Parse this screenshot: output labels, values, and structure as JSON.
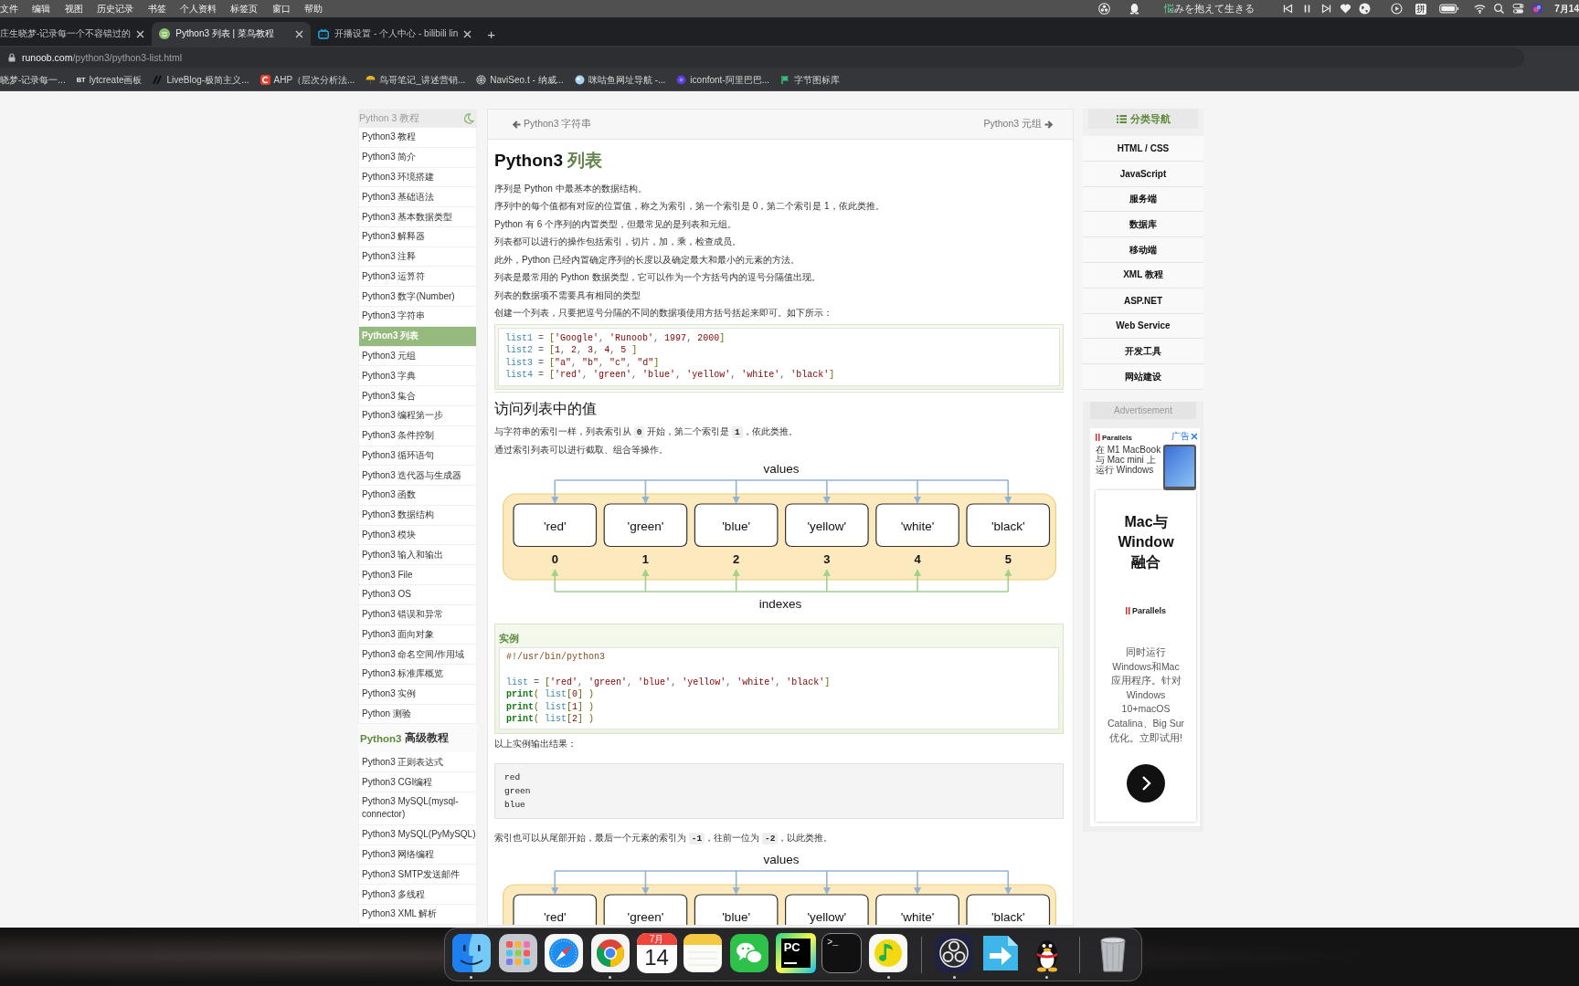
{
  "menu_bar": {
    "menus": [
      "文件",
      "编辑",
      "视图",
      "历史记录",
      "书签",
      "个人资料",
      "标签页",
      "窗口",
      "帮助"
    ],
    "now_playing": {
      "sung": "悩",
      "rest": "みを抱えて生きる"
    },
    "input_method": "拼",
    "clock": "7月14"
  },
  "tabs": [
    {
      "title": "庄生晓梦-记录每一个不容错过的",
      "kind": "cropped",
      "selected": false
    },
    {
      "title": "Python3 列表 | 菜鸟教程",
      "kind": "tutorial",
      "selected": true
    },
    {
      "title": "开播设置 - 个人中心 - bilibili lin",
      "kind": "video",
      "selected": false
    }
  ],
  "new_tab": "+",
  "address": {
    "host": "runoob.com",
    "path": "/python3/python3-list.html"
  },
  "bookmarks": [
    {
      "label": "晓梦-记录每一...",
      "kind": "cropped"
    },
    {
      "label": "lytcreate画板",
      "kind": "letters",
      "badge": "BT"
    },
    {
      "label": "LiveBlog-极简主义...",
      "kind": "slashes"
    },
    {
      "label": "AHP（层次分析法...",
      "kind": "ring-tile"
    },
    {
      "label": "鸟哥笔记_讲述营销...",
      "kind": "umbrella"
    },
    {
      "label": "NaviSeo.t - 纳威...",
      "kind": "globe"
    },
    {
      "label": "咪咕鱼网址导航 -...",
      "kind": "bubble"
    },
    {
      "label": "iconfont-阿里巴巴...",
      "kind": "disc"
    },
    {
      "label": "字节图标库",
      "kind": "flag"
    }
  ],
  "sidebar": {
    "header": "Python 3 教程",
    "items": [
      {
        "label": "Python3 教程",
        "selected": false
      },
      {
        "label": "Python3 简介",
        "selected": false
      },
      {
        "label": "Python3 环境搭建",
        "selected": false
      },
      {
        "label": "Python3 基础语法",
        "selected": false
      },
      {
        "label": "Python3 基本数据类型",
        "selected": false
      },
      {
        "label": "Python3 解释器",
        "selected": false
      },
      {
        "label": "Python3 注释",
        "selected": false
      },
      {
        "label": "Python3 运算符",
        "selected": false
      },
      {
        "label": "Python3 数字(Number)",
        "selected": false
      },
      {
        "label": "Python3 字符串",
        "selected": false
      },
      {
        "label": "Python3 列表",
        "selected": true
      },
      {
        "label": "Python3 元组",
        "selected": false
      },
      {
        "label": "Python3 字典",
        "selected": false
      },
      {
        "label": "Python3 集合",
        "selected": false
      },
      {
        "label": "Python3 编程第一步",
        "selected": false
      },
      {
        "label": "Python3 条件控制",
        "selected": false
      },
      {
        "label": "Python3 循环语句",
        "selected": false
      },
      {
        "label": "Python3 迭代器与生成器",
        "selected": false
      },
      {
        "label": "Python3 函数",
        "selected": false
      },
      {
        "label": "Python3 数据结构",
        "selected": false
      },
      {
        "label": "Python3 模块",
        "selected": false
      },
      {
        "label": "Python3 输入和输出",
        "selected": false
      },
      {
        "label": "Python3 File",
        "selected": false
      },
      {
        "label": "Python3 OS",
        "selected": false
      },
      {
        "label": "Python3 错误和异常",
        "selected": false
      },
      {
        "label": "Python3 面向对象",
        "selected": false
      },
      {
        "label": "Python3 命名空间/作用域",
        "selected": false
      },
      {
        "label": "Python3 标准库概览",
        "selected": false
      },
      {
        "label": "Python3 实例",
        "selected": false
      },
      {
        "label": "Python 测验",
        "selected": false
      }
    ],
    "section": {
      "lead": "Python3",
      "rest": "高级教程"
    },
    "advanced_items": [
      {
        "label": "Python3 正则表达式",
        "selected": false
      },
      {
        "label": "Python3 CGI编程",
        "selected": false
      },
      {
        "label": "Python3 MySQL(mysql-connector)",
        "selected": false
      },
      {
        "label": "Python3 MySQL(PyMySQL)",
        "selected": false
      },
      {
        "label": "Python3 网络编程",
        "selected": false
      },
      {
        "label": "Python3 SMTP发送邮件",
        "selected": false
      },
      {
        "label": "Python3 多线程",
        "selected": false
      },
      {
        "label": "Python3 XML 解析",
        "selected": false
      }
    ]
  },
  "article": {
    "prev": "Python3 字符串",
    "next": "Python3 元组",
    "title": {
      "lead": "Python3",
      "rest": "列表"
    },
    "body": [
      {
        "kind": "paragraph",
        "text": "序列是 Python 中最基本的数据结构。"
      },
      {
        "kind": "paragraph",
        "text": "序列中的每个值都有对应的位置值，称之为索引，第一个索引是 0，第二个索引是 1，依此类推。"
      },
      {
        "kind": "paragraph",
        "text": "Python 有 6 个序列的内置类型，但最常见的是列表和元组。"
      },
      {
        "kind": "paragraph",
        "text": "列表都可以进行的操作包括索引，切片，加，乘，检查成员。"
      },
      {
        "kind": "paragraph",
        "text": "此外，Python 已经内置确定序列的长度以及确定最大和最小的元素的方法。"
      },
      {
        "kind": "paragraph",
        "text": "列表是最常用的 Python 数据类型，它可以作为一个方括号内的逗号分隔值出现。"
      },
      {
        "kind": "paragraph",
        "text": "列表的数据项不需要具有相同的类型"
      },
      {
        "kind": "paragraph",
        "text": "创建一个列表，只要把逗号分隔的不同的数据项使用方括号括起来即可。如下所示："
      },
      {
        "kind": "code",
        "lines": [
          {
            "kind": "code",
            "tokens": [
              {
                "kind": "name",
                "text": "list1"
              },
              {
                "kind": "op",
                "text": " = "
              },
              {
                "kind": "punct",
                "text": "["
              },
              {
                "kind": "str",
                "text": "'Google'"
              },
              {
                "kind": "op",
                "text": ", "
              },
              {
                "kind": "str",
                "text": "'Runoob'"
              },
              {
                "kind": "op",
                "text": ", "
              },
              {
                "kind": "num",
                "text": "1997"
              },
              {
                "kind": "op",
                "text": ", "
              },
              {
                "kind": "num",
                "text": "2000"
              },
              {
                "kind": "punct",
                "text": "]"
              }
            ]
          },
          {
            "kind": "code",
            "tokens": [
              {
                "kind": "name",
                "text": "list2"
              },
              {
                "kind": "op",
                "text": " = "
              },
              {
                "kind": "punct",
                "text": "["
              },
              {
                "kind": "num",
                "text": "1"
              },
              {
                "kind": "op",
                "text": ", "
              },
              {
                "kind": "num",
                "text": "2"
              },
              {
                "kind": "op",
                "text": ", "
              },
              {
                "kind": "num",
                "text": "3"
              },
              {
                "kind": "op",
                "text": ", "
              },
              {
                "kind": "num",
                "text": "4"
              },
              {
                "kind": "op",
                "text": ", "
              },
              {
                "kind": "num",
                "text": "5"
              },
              {
                "kind": "punct",
                "text": " ]"
              }
            ]
          },
          {
            "kind": "code",
            "tokens": [
              {
                "kind": "name",
                "text": "list3"
              },
              {
                "kind": "op",
                "text": " = "
              },
              {
                "kind": "punct",
                "text": "["
              },
              {
                "kind": "str",
                "text": "\"a\""
              },
              {
                "kind": "op",
                "text": ", "
              },
              {
                "kind": "str",
                "text": "\"b\""
              },
              {
                "kind": "op",
                "text": ", "
              },
              {
                "kind": "str",
                "text": "\"c\""
              },
              {
                "kind": "op",
                "text": ", "
              },
              {
                "kind": "str",
                "text": "\"d\""
              },
              {
                "kind": "punct",
                "text": "]"
              }
            ]
          },
          {
            "kind": "code",
            "tokens": [
              {
                "kind": "name",
                "text": "list4"
              },
              {
                "kind": "op",
                "text": " = "
              },
              {
                "kind": "punct",
                "text": "["
              },
              {
                "kind": "str",
                "text": "'red'"
              },
              {
                "kind": "op",
                "text": ", "
              },
              {
                "kind": "str",
                "text": "'green'"
              },
              {
                "kind": "op",
                "text": ", "
              },
              {
                "kind": "str",
                "text": "'blue'"
              },
              {
                "kind": "op",
                "text": ", "
              },
              {
                "kind": "str",
                "text": "'yellow'"
              },
              {
                "kind": "op",
                "text": ", "
              },
              {
                "kind": "str",
                "text": "'white'"
              },
              {
                "kind": "op",
                "text": ", "
              },
              {
                "kind": "str",
                "text": "'black'"
              },
              {
                "kind": "punct",
                "text": "]"
              }
            ]
          }
        ]
      },
      {
        "kind": "heading",
        "text": "访问列表中的值"
      },
      {
        "kind": "paragraph",
        "segments": [
          {
            "kind": "text",
            "text": "与字符串的索引一样，列表索引从 "
          },
          {
            "kind": "code",
            "text": "0"
          },
          {
            "kind": "text",
            "text": " 开始，第二个索引是 "
          },
          {
            "kind": "code",
            "text": "1"
          },
          {
            "kind": "text",
            "text": "，依此类推。"
          }
        ]
      },
      {
        "kind": "paragraph",
        "text": "通过索引列表可以进行截取、组合等操作。"
      },
      {
        "kind": "diagram",
        "top_label": "values",
        "values": [
          "'red'",
          "'green'",
          "'blue'",
          "'yellow'",
          "'white'",
          "'black'"
        ],
        "indexes": [
          "0",
          "1",
          "2",
          "3",
          "4",
          "5"
        ],
        "bottom_label": "indexes"
      },
      {
        "kind": "example",
        "title": "实例",
        "lines": [
          {
            "kind": "code",
            "tokens": [
              {
                "kind": "com",
                "text": "#!/usr/bin/python3"
              }
            ]
          },
          {
            "kind": "blank"
          },
          {
            "kind": "code",
            "tokens": [
              {
                "kind": "name",
                "text": "list"
              },
              {
                "kind": "op",
                "text": " = "
              },
              {
                "kind": "punct",
                "text": "["
              },
              {
                "kind": "str",
                "text": "'red'"
              },
              {
                "kind": "op",
                "text": ", "
              },
              {
                "kind": "str",
                "text": "'green'"
              },
              {
                "kind": "op",
                "text": ", "
              },
              {
                "kind": "str",
                "text": "'blue'"
              },
              {
                "kind": "op",
                "text": ", "
              },
              {
                "kind": "str",
                "text": "'yellow'"
              },
              {
                "kind": "op",
                "text": ", "
              },
              {
                "kind": "str",
                "text": "'white'"
              },
              {
                "kind": "op",
                "text": ", "
              },
              {
                "kind": "str",
                "text": "'black'"
              },
              {
                "kind": "punct",
                "text": "]"
              }
            ]
          },
          {
            "kind": "code",
            "tokens": [
              {
                "kind": "kw",
                "text": "print"
              },
              {
                "kind": "punct",
                "text": "( "
              },
              {
                "kind": "name",
                "text": "list"
              },
              {
                "kind": "punct",
                "text": "["
              },
              {
                "kind": "num",
                "text": "0"
              },
              {
                "kind": "punct",
                "text": "] )"
              }
            ]
          },
          {
            "kind": "code",
            "tokens": [
              {
                "kind": "kw",
                "text": "print"
              },
              {
                "kind": "punct",
                "text": "( "
              },
              {
                "kind": "name",
                "text": "list"
              },
              {
                "kind": "punct",
                "text": "["
              },
              {
                "kind": "num",
                "text": "1"
              },
              {
                "kind": "punct",
                "text": "] )"
              }
            ]
          },
          {
            "kind": "code",
            "tokens": [
              {
                "kind": "kw",
                "text": "print"
              },
              {
                "kind": "punct",
                "text": "( "
              },
              {
                "kind": "name",
                "text": "list"
              },
              {
                "kind": "punct",
                "text": "["
              },
              {
                "kind": "num",
                "text": "2"
              },
              {
                "kind": "punct",
                "text": "] )"
              }
            ]
          }
        ]
      },
      {
        "kind": "paragraph",
        "text": "以上实例输出结果："
      },
      {
        "kind": "output",
        "lines": [
          "red",
          "green",
          "blue"
        ]
      },
      {
        "kind": "paragraph",
        "segments": [
          {
            "kind": "text",
            "text": "索引也可以从尾部开始，最后一个元素的索引为 "
          },
          {
            "kind": "code",
            "text": "-1"
          },
          {
            "kind": "text",
            "text": "，往前一位为 "
          },
          {
            "kind": "code",
            "text": "-2"
          },
          {
            "kind": "text",
            "text": "，以此类推。"
          }
        ]
      },
      {
        "kind": "diagram",
        "top_label": "values",
        "values": [
          "'red'",
          "'green'",
          "'blue'",
          "'yellow'",
          "'white'",
          "'black'"
        ]
      }
    ]
  },
  "category_nav": {
    "header": "分类导航",
    "items": [
      "HTML / CSS",
      "JavaScript",
      "服务端",
      "数据库",
      "移动端",
      "XML 教程",
      "ASP.NET",
      "Web Service",
      "开发工具",
      "网站建设"
    ]
  },
  "ad": {
    "header": "Advertisement",
    "ad_label": "广告",
    "brand": "Parallels",
    "caption_lines": [
      "在 M1 MacBook",
      "与 Mac mini 上",
      "运行 Windows"
    ],
    "headline_lines": [
      "Mac与",
      "Window",
      "融合"
    ],
    "card_brand": "Parallels",
    "body_lines": [
      "同时运行",
      "Windows和Mac",
      "应用程序。针对",
      "Windows",
      "10+macOS",
      "Catalina、Big Sur",
      "优化。立即试用!"
    ]
  },
  "dock": {
    "groups": [
      [
        {
          "kind": "finder",
          "running": true
        },
        {
          "kind": "launchpad",
          "running": false
        },
        {
          "kind": "safari",
          "running": false
        },
        {
          "kind": "chrome",
          "running": true
        },
        {
          "kind": "calendar",
          "running": false,
          "month": "7月",
          "day": "14"
        },
        {
          "kind": "notes",
          "running": false
        },
        {
          "kind": "wechat",
          "running": false
        },
        {
          "kind": "pycharm",
          "running": false,
          "label": "PC"
        },
        {
          "kind": "terminal",
          "running": false,
          "label": ">_"
        },
        {
          "kind": "music",
          "running": true
        }
      ],
      [
        {
          "kind": "obs",
          "running": true
        },
        {
          "kind": "transfer",
          "running": false
        },
        {
          "kind": "penguin",
          "running": true
        }
      ],
      [
        {
          "kind": "trash",
          "running": false
        }
      ]
    ]
  }
}
